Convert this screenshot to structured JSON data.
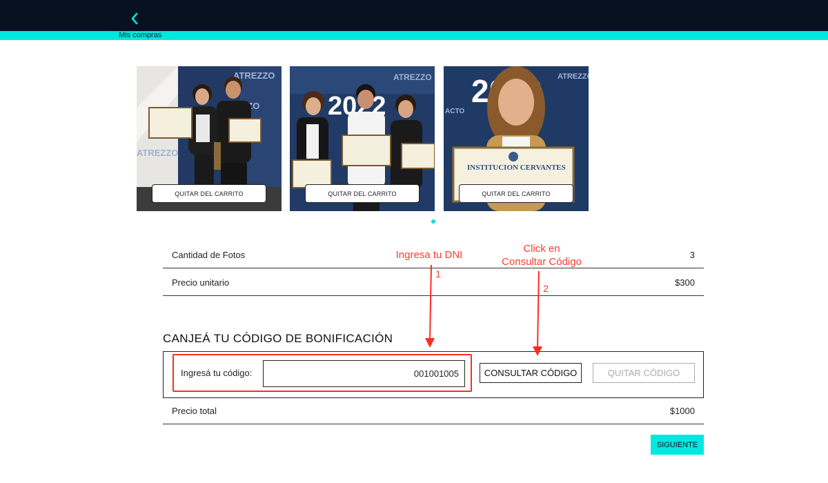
{
  "header": {
    "breadcrumb": "Mis compras",
    "back_icon": "chevron-left-icon",
    "accent_color": "#00e8e0",
    "bar_color": "#06121f"
  },
  "cart": {
    "items": [
      {
        "remove_label": "QUITAR DEL CARRITO"
      },
      {
        "remove_label": "QUITAR DEL CARRITO"
      },
      {
        "remove_label": "QUITAR DEL CARRITO"
      }
    ],
    "photo_text": {
      "brand": "ATREZZO",
      "year": "2022",
      "act": "ACTO",
      "institution": "INSTITUCION CERVANTES"
    }
  },
  "summary": {
    "quantity_label": "Cantidad de Fotos",
    "quantity_value": "3",
    "unit_price_label": "Precio unitario",
    "unit_price_value": "$300",
    "total_label": "Precio total",
    "total_value": "$1000"
  },
  "voucher": {
    "title": "CANJEÁ TU CÓDIGO DE BONIFICACIÓN",
    "input_label": "Ingresá tu código:",
    "input_value": "001001005",
    "consult_label": "CONSULTAR CÓDIGO",
    "remove_label": "QUITAR CÓDIGO"
  },
  "next_label": "SIGUIENTE",
  "annotations": {
    "step1_text": "Ingresa tu DNI",
    "step1_number": "1",
    "step2_line1": "Click en",
    "step2_line2": "Consultar Código",
    "step2_number": "2",
    "color": "#ff3b2f"
  }
}
